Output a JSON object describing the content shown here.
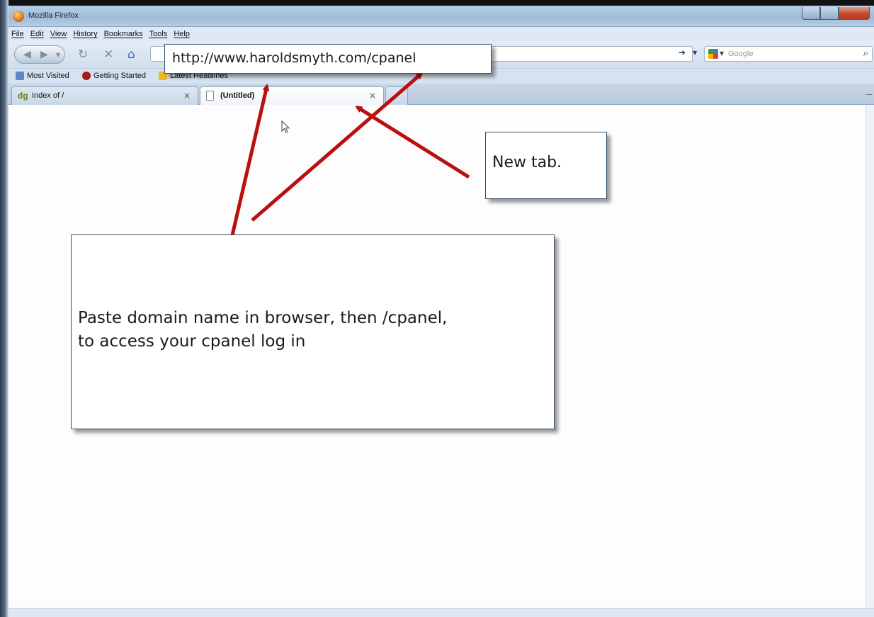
{
  "window": {
    "title": "Mozilla Firefox",
    "icon": "firefox-logo-icon"
  },
  "menu": {
    "items": [
      "File",
      "Edit",
      "View",
      "History",
      "Bookmarks",
      "Tools",
      "Help"
    ]
  },
  "navigation": {
    "search_placeholder": "Google"
  },
  "bookmarks": {
    "items": [
      "Most Visited",
      "Getting Started",
      "Latest Headlines"
    ]
  },
  "tabs": [
    {
      "label": "Index of /",
      "icon": "dg-favicon-icon",
      "close": "×"
    },
    {
      "label": "(Untitled)",
      "icon": "blank-page-icon",
      "close": "×"
    }
  ],
  "callouts": {
    "url": "http://www.haroldsmyth.com/cpanel",
    "new_tab": "New tab.",
    "instructions_line1": "Paste domain name in browser, then /cpanel,",
    "instructions_line2": "to access your cpanel log in"
  },
  "colors": {
    "arrow": "#bb0f0f",
    "chrome": "#d2deec",
    "callout_border": "#344e68"
  }
}
